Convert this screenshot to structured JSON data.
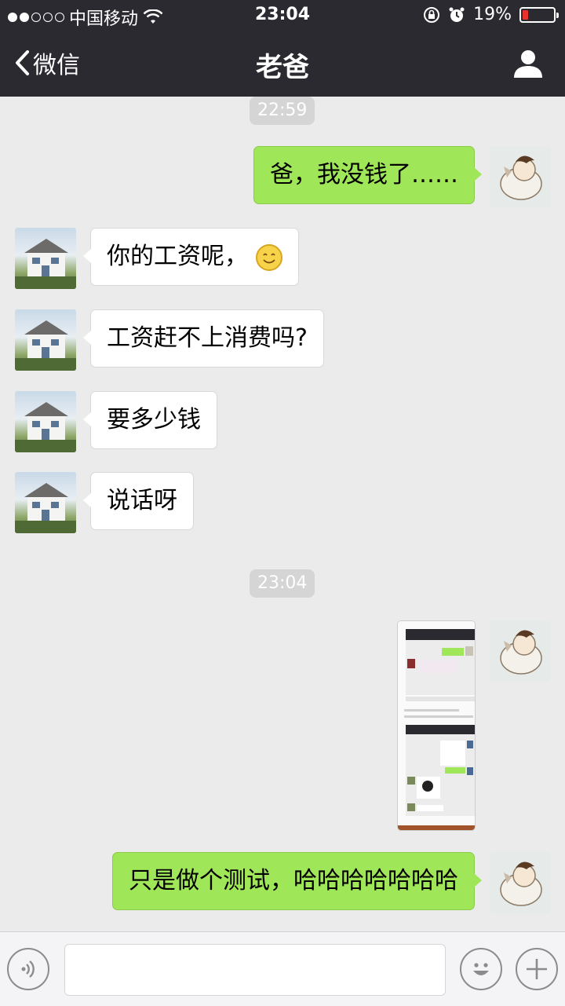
{
  "status_bar": {
    "carrier": "中国移动",
    "time": "23:04",
    "battery": "19%",
    "battery_level": 0.19
  },
  "navbar": {
    "back_label": "微信",
    "title": "老爸"
  },
  "chat": {
    "timestamps": [
      "22:59",
      "23:04"
    ],
    "messages": [
      {
        "sender": "me",
        "text": "爸，我没钱了……"
      },
      {
        "sender": "dad",
        "text": "你的工资呢，"
      },
      {
        "sender": "dad",
        "text": "工资赶不上消费吗?"
      },
      {
        "sender": "dad",
        "text": "要多少钱"
      },
      {
        "sender": "dad",
        "text": "说话呀"
      },
      {
        "sender": "me",
        "type": "image"
      },
      {
        "sender": "me",
        "text": "只是做个测试，哈哈哈哈哈哈哈"
      }
    ]
  },
  "colors": {
    "topbar_bg": "#2b2a30",
    "chat_bg": "#ebebeb",
    "outgoing_bubble": "#9fe658",
    "incoming_bubble": "#ffffff",
    "battery_low": "#e8332c"
  }
}
